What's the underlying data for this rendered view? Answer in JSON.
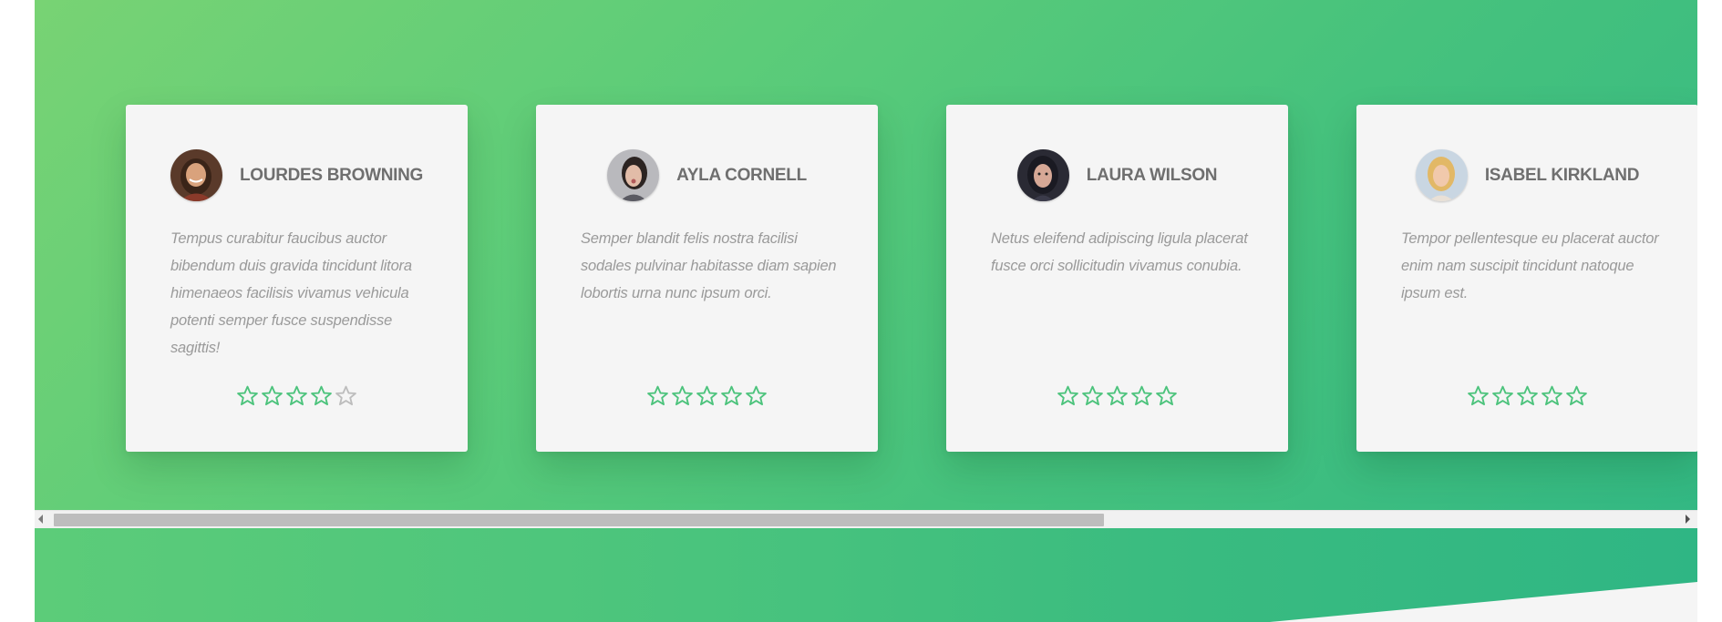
{
  "theme": {
    "accent": "#4cc37c",
    "card_bg": "#f5f5f5",
    "star_filled": "#4cc37c",
    "star_empty": "#bdbdbd"
  },
  "testimonials": [
    {
      "name": "LOURDES BROWNING",
      "quote": "Tempus curabitur faucibus auctor bibendum duis gravida tincidunt litora himenaeos facilisis vivamus vehicula potenti semper fusce suspendisse sagittis!",
      "rating": 4,
      "max_rating": 5,
      "avatar": "woman-smiling-avatar"
    },
    {
      "name": "AYLA CORNELL",
      "quote": "Semper blandit felis nostra facilisi sodales pulvinar habitasse diam sapien lobortis urna nunc ipsum orci.",
      "rating": 5,
      "max_rating": 5,
      "avatar": "woman-dark-hair-avatar"
    },
    {
      "name": "LAURA WILSON",
      "quote": "Netus eleifend adipiscing ligula placerat fusce orci sollicitudin vivamus conubia.",
      "rating": 5,
      "max_rating": 5,
      "avatar": "woman-portrait-avatar"
    },
    {
      "name": "ISABEL KIRKLAND",
      "quote": "Tempor pellentesque eu placerat auctor enim nam suscipit tincidunt natoque ipsum est.",
      "rating": 5,
      "max_rating": 5,
      "avatar": "woman-blonde-avatar"
    }
  ],
  "scrollbar": {
    "orientation": "horizontal",
    "thumb_fraction": 0.63,
    "scroll_position": 0
  }
}
